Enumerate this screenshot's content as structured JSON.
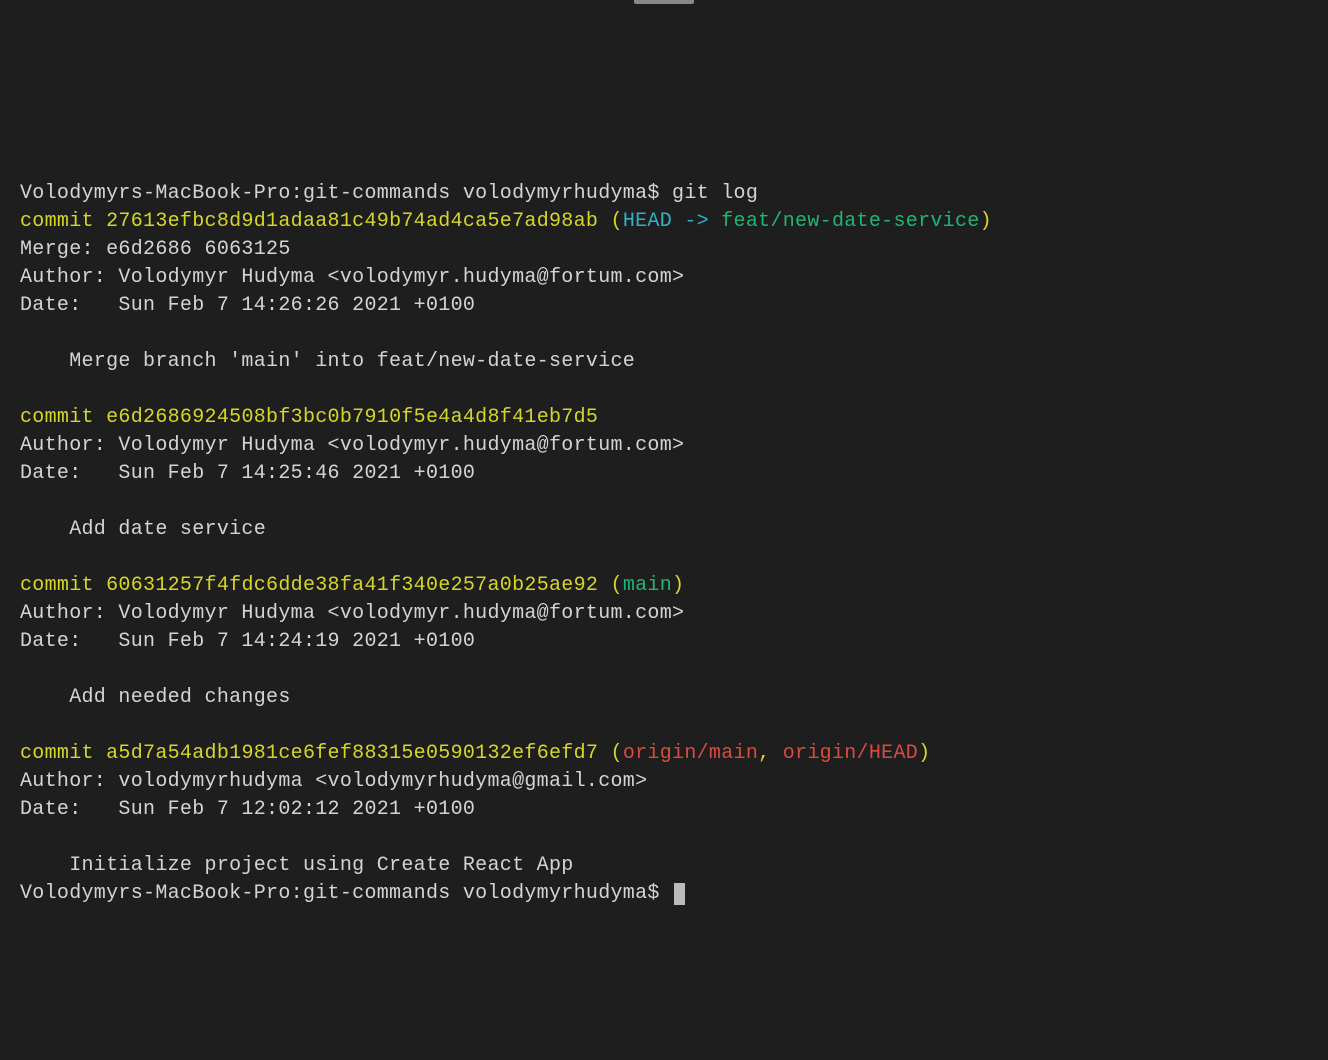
{
  "prompt1": {
    "host": "Volodymyrs-MacBook-Pro:git-commands volodymyrhudyma$ ",
    "command": "git log"
  },
  "commits": [
    {
      "commit_label": "commit ",
      "hash": "27613efbc8d9d1adaa81c49b74ad4ca5e7ad98ab",
      "refs_open": " (",
      "refs_head": "HEAD -> ",
      "refs_branch": "feat/new-date-service",
      "refs_close": ")",
      "merge": "Merge: e6d2686 6063125",
      "author": "Author: Volodymyr Hudyma <volodymyr.hudyma@fortum.com>",
      "date": "Date:   Sun Feb 7 14:26:26 2021 +0100",
      "message": "    Merge branch 'main' into feat/new-date-service"
    },
    {
      "commit_label": "commit ",
      "hash": "e6d2686924508bf3bc0b7910f5e4a4d8f41eb7d5",
      "author": "Author: Volodymyr Hudyma <volodymyr.hudyma@fortum.com>",
      "date": "Date:   Sun Feb 7 14:25:46 2021 +0100",
      "message": "    Add date service"
    },
    {
      "commit_label": "commit ",
      "hash": "60631257f4fdc6dde38fa41f340e257a0b25ae92",
      "refs_open": " (",
      "refs_branch": "main",
      "refs_close": ")",
      "author": "Author: Volodymyr Hudyma <volodymyr.hudyma@fortum.com>",
      "date": "Date:   Sun Feb 7 14:24:19 2021 +0100",
      "message": "    Add needed changes"
    },
    {
      "commit_label": "commit ",
      "hash": "a5d7a54adb1981ce6fef88315e0590132ef6efd7",
      "refs_open": " (",
      "refs_remote1": "origin/main",
      "refs_comma": ", ",
      "refs_remote2": "origin/HEAD",
      "refs_close": ")",
      "author": "Author: volodymyrhudyma <volodymyrhudyma@gmail.com>",
      "date": "Date:   Sun Feb 7 12:02:12 2021 +0100",
      "message": "    Initialize project using Create React App"
    }
  ],
  "prompt2": {
    "host": "Volodymyrs-MacBook-Pro:git-commands volodymyrhudyma$ "
  }
}
